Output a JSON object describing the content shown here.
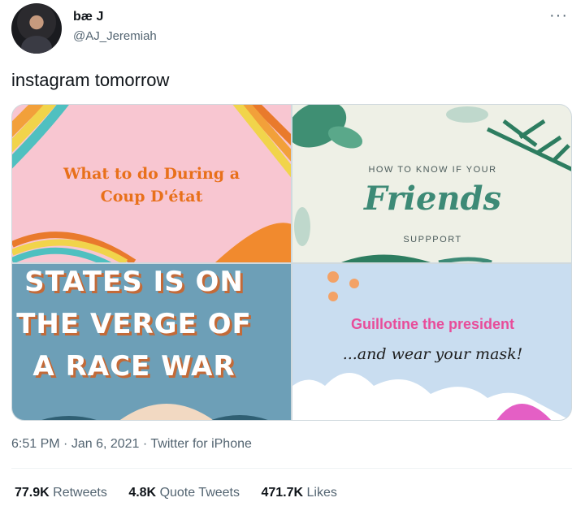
{
  "user": {
    "display_name": "bæ J",
    "handle": "@AJ_Jeremiah"
  },
  "more_icon": "ellipsis-icon",
  "tweet": {
    "text": "instagram tomorrow"
  },
  "media": {
    "tile1": {
      "line1": "What to do During a",
      "line2": "Coup D'état",
      "colors": {
        "bg": "#f8c6d1",
        "text": "#e8701a"
      }
    },
    "tile2": {
      "top": "HOW TO KNOW IF YOUR",
      "title": "Friends",
      "bottom": "SUPPPORT",
      "colors": {
        "bg": "#eef0e6",
        "title": "#3d8a76"
      }
    },
    "tile3": {
      "line1": "STATES IS ON",
      "line2": "THE VERGE OF",
      "line3": "A RACE WAR",
      "colors": {
        "bg": "#6d9fb7",
        "shadow": "#c36a38"
      }
    },
    "tile4": {
      "line1": "Guillotine the president",
      "line2": "...and wear your mask!",
      "colors": {
        "bg": "#c9ddf0",
        "pink": "#e84d9a"
      }
    }
  },
  "meta": {
    "time": "6:51 PM",
    "sep1": "·",
    "date": "Jan 6, 2021",
    "sep2": "·",
    "source": "Twitter for iPhone"
  },
  "stats": [
    {
      "count": "77.9K",
      "label": "Retweets"
    },
    {
      "count": "4.8K",
      "label": "Quote Tweets"
    },
    {
      "count": "471.7K",
      "label": "Likes"
    }
  ]
}
